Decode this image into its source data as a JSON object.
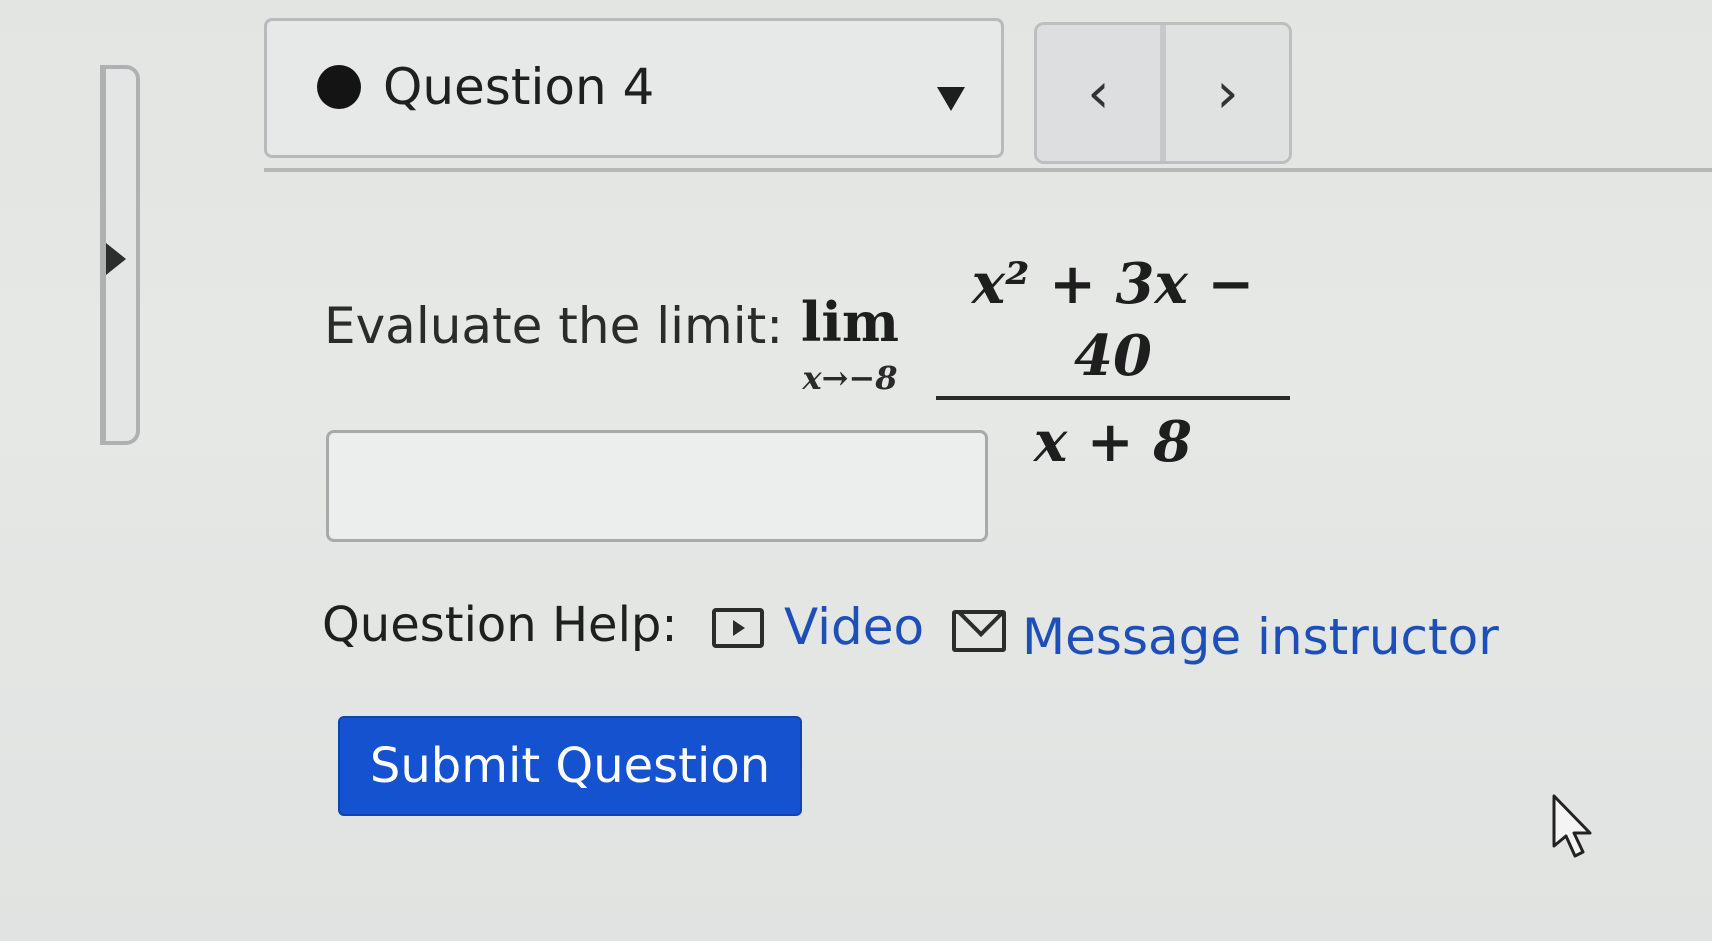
{
  "question_selector": {
    "label": "Question 4",
    "status": "attempted"
  },
  "navigation": {
    "prev_symbol": "‹",
    "next_symbol": "›"
  },
  "problem": {
    "prompt": "Evaluate the limit:",
    "lim_word": "lim",
    "lim_subscript": "x→−8",
    "numerator": "x² + 3x − 40",
    "denominator": "x + 8"
  },
  "answer": {
    "value": "",
    "placeholder": ""
  },
  "help": {
    "label": "Question Help:",
    "video_label": "Video",
    "message_label": "Message instructor"
  },
  "submit": {
    "label": "Submit Question"
  },
  "colors": {
    "link": "#1e4fb8",
    "primary_button": "#1552cf"
  },
  "icons": [
    "status-dot-icon",
    "dropdown-caret-icon",
    "chevron-left-icon",
    "chevron-right-icon",
    "video-icon",
    "mail-icon",
    "cursor-icon"
  ]
}
